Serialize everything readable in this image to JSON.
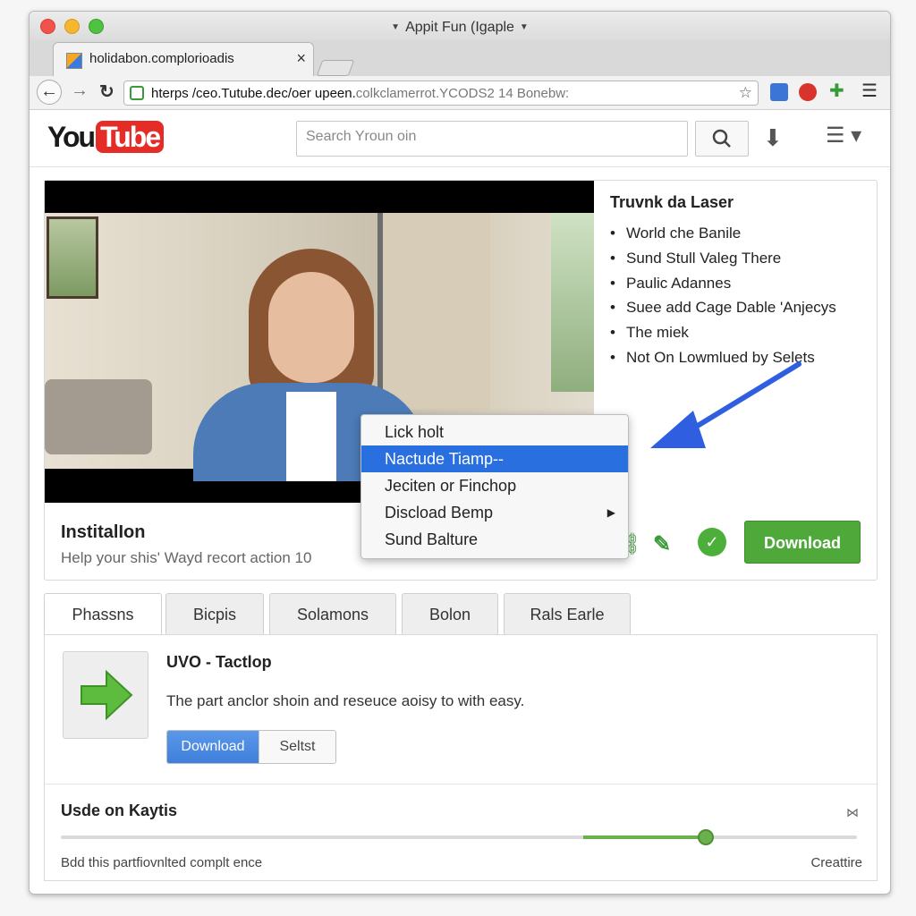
{
  "window": {
    "title": "Appit Fun (Igaple"
  },
  "tab": {
    "title": "holidabon.complorioadis",
    "close": "×"
  },
  "address_bar": {
    "url_main": "hterps /ceo.Tutube.dec/oer upeen.",
    "url_rest": "colkclamerrot.YCODS2 14 Bonebw:"
  },
  "youtube": {
    "logo_you": "You",
    "logo_tube": "Tube",
    "search_placeholder": "Search Yroun oin"
  },
  "video_card": {
    "title": "InstitalIon",
    "subtitle": "Help your shis' Wayd recort action 10",
    "download_label": "Download"
  },
  "sidebar": {
    "heading": "Truvnk da Laser",
    "items": [
      "World che Banile",
      "Sund Stull Valeg There",
      "Paulic Adannes",
      "Suee add Cage Dable 'Anjecys",
      "The miek",
      "Not On Lowmlued by Selets"
    ]
  },
  "context_menu": {
    "items": [
      "Lick holt",
      "Nactude Tiamp--",
      "Jeciten or Finchop",
      "Discload Bemp",
      "Sund Balture"
    ],
    "selected_index": 1
  },
  "tabs": [
    "Phassns",
    "Bicpis",
    "Solamons",
    "Bolon",
    "Rals Earle"
  ],
  "panel": {
    "title": "UVO - Tactlop",
    "description": "The part anclor shoin and reseuce aoisy to with easy.",
    "seg_download": "Download",
    "seg_select": "Seltst",
    "footer_title": "Usde on Kaytis",
    "footer_left": "Bdd this partfiovnlted complt ence",
    "footer_right": "Creattire",
    "slider_fraction": 0.81
  },
  "colors": {
    "accent_blue": "#2a6fe0",
    "download_green": "#4ea83a",
    "youtube_red": "#e52d27"
  }
}
